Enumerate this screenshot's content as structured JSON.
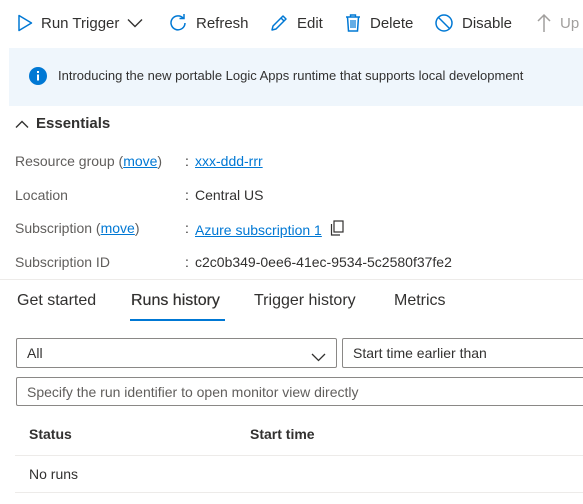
{
  "toolbar": {
    "run_trigger": "Run Trigger",
    "refresh": "Refresh",
    "edit": "Edit",
    "delete": "Delete",
    "disable": "Disable",
    "update_partial": "Up"
  },
  "banner": {
    "text": "Introducing the new portable Logic Apps runtime that supports local development"
  },
  "essentials": {
    "title": "Essentials",
    "resource_group_label": "Resource group",
    "move1": "move",
    "resource_group_value": "xxx-ddd-rrr",
    "location_label": "Location",
    "location_value": "Central US",
    "subscription_label": "Subscription",
    "move2": "move",
    "subscription_value": "Azure subscription 1",
    "subscription_id_label": "Subscription ID",
    "subscription_id_value": "c2c0b349-0ee6-41ec-9534-5c2580f37fe2"
  },
  "tabs": [
    {
      "label": "Get started"
    },
    {
      "label": "Runs history"
    },
    {
      "label": "Trigger history"
    },
    {
      "label": "Metrics"
    }
  ],
  "filters": {
    "status_value": "All",
    "start_time_value": "Start time earlier than",
    "run_id_placeholder": "Specify the run identifier to open monitor view directly"
  },
  "table": {
    "columns": [
      "Status",
      "Start time"
    ],
    "empty_text": "No runs"
  },
  "colors": {
    "accent": "#0078d4",
    "banner_bg": "#eff6fc"
  }
}
